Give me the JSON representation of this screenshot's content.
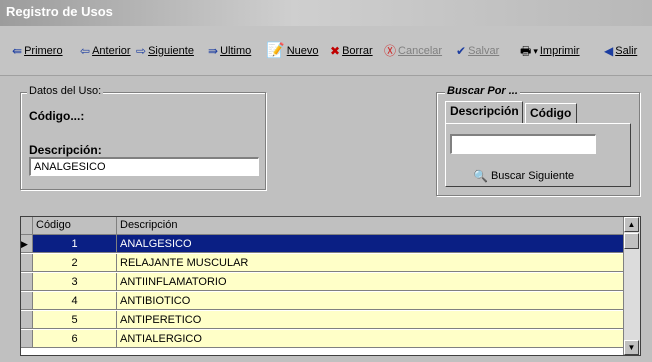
{
  "window": {
    "title": "Registro de Usos"
  },
  "toolbar": {
    "first": {
      "label": "Primero",
      "icon": "first-arrow-icon"
    },
    "previous": {
      "label": "Anterior",
      "icon": "previous-arrow-icon"
    },
    "next": {
      "label": "Siguiente",
      "icon": "next-arrow-icon"
    },
    "last": {
      "label": "Ultimo",
      "icon": "last-arrow-icon"
    },
    "new": {
      "label": "Nuevo",
      "icon": "new-document-icon"
    },
    "delete": {
      "label": "Borrar",
      "icon": "delete-icon"
    },
    "cancel": {
      "label": "Cancelar",
      "icon": "cancel-icon"
    },
    "save": {
      "label": "Salvar",
      "icon": "save-check-icon"
    },
    "print": {
      "label": "Imprimir",
      "icon": "printer-icon"
    },
    "exit": {
      "label": "Salir",
      "icon": "exit-arrow-icon"
    }
  },
  "datos": {
    "title": "Datos del Uso:",
    "codigo_label": "Código...:",
    "descripcion_label": "Descripción:",
    "descripcion_value": "ANALGESICO"
  },
  "buscar": {
    "title": "Buscar Por ...",
    "tabs": [
      "Descripción",
      "Código"
    ],
    "search_value": "",
    "next_label": "Buscar Siguiente"
  },
  "grid": {
    "columns": [
      "Código",
      "Descripción"
    ],
    "rows": [
      {
        "code": "1",
        "desc": "ANALGESICO"
      },
      {
        "code": "2",
        "desc": "RELAJANTE MUSCULAR"
      },
      {
        "code": "3",
        "desc": "ANTIINFLAMATORIO"
      },
      {
        "code": "4",
        "desc": "ANTIBIOTICO"
      },
      {
        "code": "5",
        "desc": "ANTIPERETICO"
      },
      {
        "code": "6",
        "desc": "ANTIALERGICO"
      }
    ]
  },
  "colors": {
    "selected_row": "#0a1f84",
    "row_bg": "#ffffc8"
  }
}
